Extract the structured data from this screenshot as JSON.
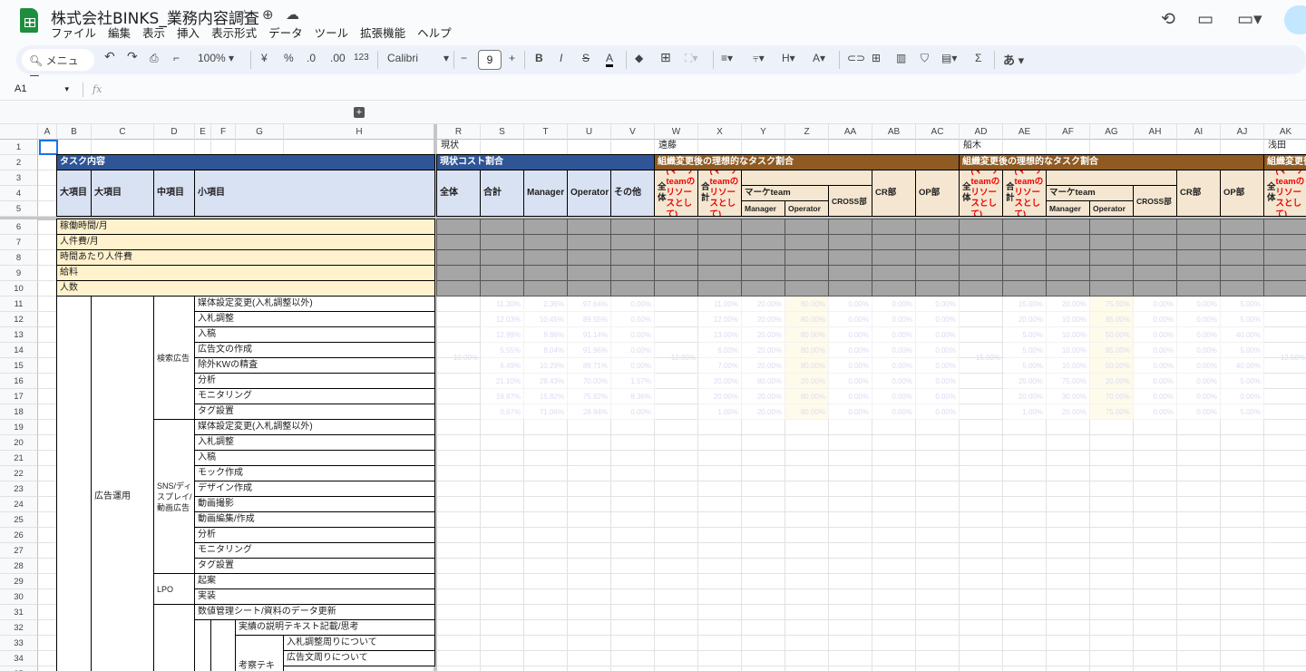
{
  "doc": {
    "title": "株式会社BINKS_業務内容調査",
    "menu": [
      "ファイル",
      "編集",
      "表示",
      "挿入",
      "表示形式",
      "データ",
      "ツール",
      "拡張機能",
      "ヘルプ"
    ]
  },
  "toolbar": {
    "search": "メニュー",
    "zoom": "100%",
    "currency": "¥",
    "percent": "%",
    "dec_minus": ".0",
    "dec_plus": ".00",
    "format": "123",
    "font": "Calibri",
    "font_size": "9",
    "bold": "B",
    "italic": "I",
    "input_tool": "あ"
  },
  "formula": {
    "cell_ref": "A1",
    "fx": "fx",
    "value": ""
  },
  "columns": {
    "left": [
      "A",
      "B",
      "C",
      "D",
      "E",
      "F",
      "G",
      "H"
    ],
    "right": [
      "R",
      "S",
      "T",
      "U",
      "V",
      "W",
      "X",
      "Y",
      "Z",
      "AA",
      "AB",
      "AC",
      "AD",
      "AE",
      "AF",
      "AG",
      "AH",
      "AI",
      "AJ",
      "AK"
    ]
  },
  "sheet": {
    "row1": {
      "genjo": "現状",
      "endo": "遠藤",
      "funaki": "船木",
      "asada": "浅田"
    },
    "task_header": "タスク内容",
    "col_heads": [
      "大項目",
      "大項目",
      "中項目",
      "小項目"
    ],
    "metrics": [
      "稼働時間/月",
      "人件費/月",
      "時間あたり人件費",
      "給料",
      "人数"
    ],
    "current_header": "現状コスト割合",
    "current_cols": [
      "全体",
      "合計",
      "Manager",
      "Operator",
      "その他"
    ],
    "ideal_header": "組織変更後の理想的なタスク割合",
    "ideal_cols": {
      "zentai": "全体",
      "goukei": "合計",
      "paren": "(マーケteamのリソースとして)",
      "marke": "マーケteam",
      "manager": "Manager",
      "operator": "Operator",
      "cross": "CROSS部",
      "cr": "CR部",
      "op": "OP部"
    },
    "category": "広告運用",
    "groups": [
      "検索広告",
      "SNS/ディスプレイ/動画広告",
      "LPO"
    ],
    "items": [
      "媒体設定変更(入札調整以外)",
      "入札調整",
      "入稿",
      "広告文の作成",
      "除外KWの精査",
      "分析",
      "モニタリング",
      "タグ設置",
      "媒体設定変更(入札調整以外)",
      "入札調整",
      "入稿",
      "モック作成",
      "デザイン作成",
      "動画撮影",
      "動画編集/作成",
      "分析",
      "モニタリング",
      "タグ設置",
      "起案",
      "実装",
      "数値管理シート/資料のデータ更新"
    ],
    "item32": "実績の説明テキスト記載/思考",
    "item33_g": "考察テキ",
    "item33": "入札調整周りについて",
    "item34": "広告文周りについて",
    "merged": {
      "genjo": "10.00%",
      "endo": "12.00%",
      "funaki": "15.00%",
      "asada": "12.50%"
    },
    "data_rows": [
      [
        "",
        "11.30%",
        "2.36%",
        "97.64%",
        "0.00%",
        "",
        "11.00%",
        "20.00%",
        "80.00%",
        "0.00%",
        "0.00%",
        "0.00%",
        "",
        "15.00%",
        "20.00%",
        "75.00%",
        "0.00%",
        "0.00%",
        "5.00%",
        ""
      ],
      [
        "",
        "12.03%",
        "10.45%",
        "89.55%",
        "0.00%",
        "",
        "12.00%",
        "20.00%",
        "80.00%",
        "0.00%",
        "0.00%",
        "0.00%",
        "",
        "20.00%",
        "10.00%",
        "85.00%",
        "0.00%",
        "0.00%",
        "5.00%",
        ""
      ],
      [
        "",
        "12.99%",
        "8.86%",
        "91.14%",
        "0.00%",
        "",
        "13.00%",
        "20.00%",
        "80.00%",
        "0.00%",
        "0.00%",
        "0.00%",
        "",
        "5.00%",
        "10.00%",
        "50.00%",
        "0.00%",
        "0.00%",
        "40.00%",
        ""
      ],
      [
        "",
        "5.55%",
        "8.04%",
        "91.96%",
        "0.00%",
        "",
        "6.00%",
        "20.00%",
        "80.00%",
        "0.00%",
        "0.00%",
        "0.00%",
        "",
        "5.00%",
        "10.00%",
        "85.00%",
        "0.00%",
        "0.00%",
        "5.00%",
        ""
      ],
      [
        "",
        "6.49%",
        "10.29%",
        "89.71%",
        "0.00%",
        "",
        "7.00%",
        "20.00%",
        "80.00%",
        "0.00%",
        "0.00%",
        "0.00%",
        "",
        "5.00%",
        "10.00%",
        "50.00%",
        "0.00%",
        "0.00%",
        "40.00%",
        ""
      ],
      [
        "",
        "21.10%",
        "28.43%",
        "70.00%",
        "1.57%",
        "",
        "20.00%",
        "80.00%",
        "20.00%",
        "0.00%",
        "0.00%",
        "0.00%",
        "",
        "25.00%",
        "75.00%",
        "20.00%",
        "0.00%",
        "0.00%",
        "5.00%",
        ""
      ],
      [
        "",
        "19.87%",
        "15.82%",
        "75.82%",
        "8.36%",
        "",
        "20.00%",
        "20.00%",
        "80.00%",
        "0.00%",
        "0.00%",
        "0.00%",
        "",
        "20.00%",
        "30.00%",
        "70.00%",
        "0.00%",
        "0.00%",
        "0.00%",
        ""
      ],
      [
        "",
        "0.67%",
        "71.06%",
        "28.94%",
        "0.00%",
        "",
        "1.00%",
        "20.00%",
        "80.00%",
        "0.00%",
        "0.00%",
        "0.00%",
        "",
        "1.00%",
        "20.00%",
        "75.00%",
        "0.00%",
        "0.00%",
        "5.00%",
        ""
      ]
    ]
  }
}
